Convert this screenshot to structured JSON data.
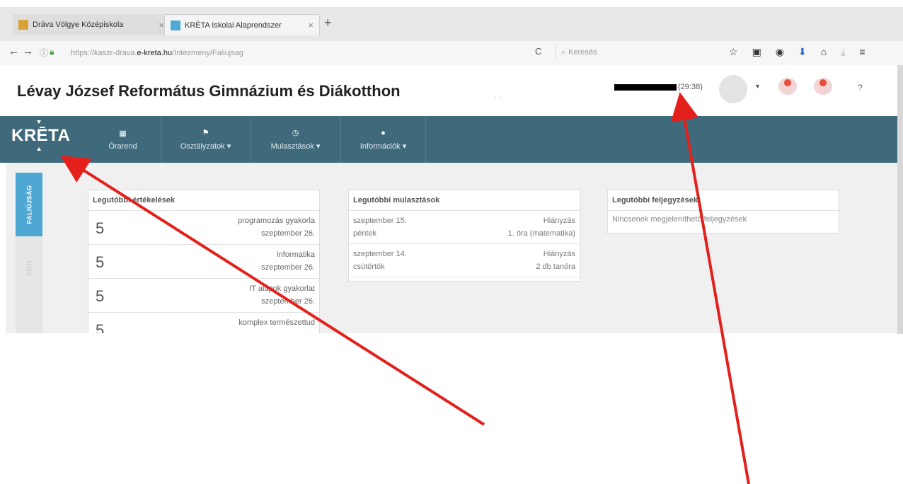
{
  "browser": {
    "tabs": [
      {
        "title": "Dráva Völgye Középiskola",
        "close": "×"
      },
      {
        "title": "KRÉTA Iskolai Alaprendszer",
        "close": "×"
      }
    ],
    "new_tab": "+",
    "url_prefix": "https://kaszr-drava.",
    "url_domain": "e-kreta.hu",
    "url_path": "/Intezmeny/Faliujsag",
    "search_placeholder": "Keresés",
    "reload": "C"
  },
  "header": {
    "school_name": "Lévay József Református Gimnázium és Diákotthon",
    "dots": ". .",
    "timer": "(29:38)",
    "help": "?"
  },
  "nav": {
    "logo": "KRĒTA",
    "items": [
      {
        "label": "Órarend",
        "icon": "calendar-icon"
      },
      {
        "label": "Osztályzatok ▾",
        "icon": "flag-icon"
      },
      {
        "label": "Mulasztások ▾",
        "icon": "clock-icon"
      },
      {
        "label": "Információk ▾",
        "icon": "info-icon"
      }
    ]
  },
  "side_tabs": [
    {
      "label": "FALIÚJSÁG"
    },
    {
      "label": "SÜTI"
    }
  ],
  "panels": {
    "grades": {
      "title": "Legutóbbi értékelések",
      "rows": [
        {
          "grade": "5",
          "subject": "programozás gyakorla",
          "date": "szeptember 26."
        },
        {
          "grade": "5",
          "subject": "informatika",
          "date": "szeptember 26."
        },
        {
          "grade": "5",
          "subject": "IT alapok gyakorlat",
          "date": "szeptember 26."
        },
        {
          "grade": "5",
          "subject": "komplex természettud",
          "date": ""
        }
      ]
    },
    "absences": {
      "title": "Legutóbbi mulasztások",
      "rows": [
        {
          "date": "szeptember 15.",
          "day": "péntek",
          "type": "Hiányzás",
          "detail": "1. óra (matematika)"
        },
        {
          "date": "szeptember 14.",
          "day": "csütörtök",
          "type": "Hiányzás",
          "detail": "2 db tanóra"
        }
      ]
    },
    "notes": {
      "title": "Legutóbbi feljegyzések",
      "empty_text": "Nincsenek megjeleníthető feljegyzések"
    }
  },
  "colors": {
    "nav_bg": "#3f6a7b",
    "side_active": "#4fa7d3",
    "arrow": "#e3201b"
  }
}
